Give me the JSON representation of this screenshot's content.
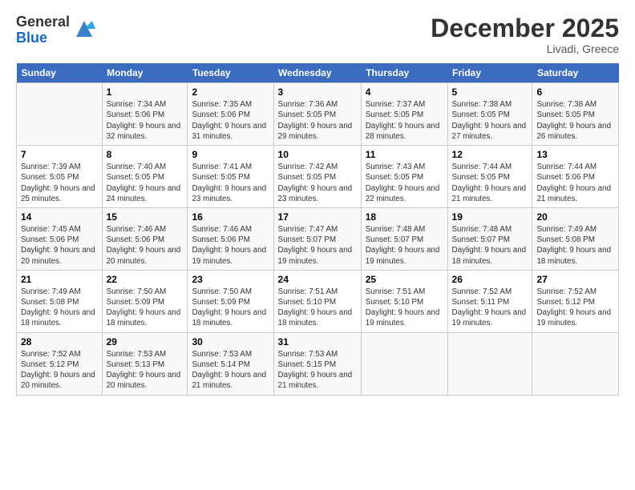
{
  "header": {
    "logo_general": "General",
    "logo_blue": "Blue",
    "month_title": "December 2025",
    "location": "Livadi, Greece"
  },
  "days_of_week": [
    "Sunday",
    "Monday",
    "Tuesday",
    "Wednesday",
    "Thursday",
    "Friday",
    "Saturday"
  ],
  "weeks": [
    [
      {
        "num": "",
        "sunrise": "",
        "sunset": "",
        "daylight": "",
        "empty": true
      },
      {
        "num": "1",
        "sunrise": "Sunrise: 7:34 AM",
        "sunset": "Sunset: 5:06 PM",
        "daylight": "Daylight: 9 hours and 32 minutes.",
        "empty": false
      },
      {
        "num": "2",
        "sunrise": "Sunrise: 7:35 AM",
        "sunset": "Sunset: 5:06 PM",
        "daylight": "Daylight: 9 hours and 31 minutes.",
        "empty": false
      },
      {
        "num": "3",
        "sunrise": "Sunrise: 7:36 AM",
        "sunset": "Sunset: 5:05 PM",
        "daylight": "Daylight: 9 hours and 29 minutes.",
        "empty": false
      },
      {
        "num": "4",
        "sunrise": "Sunrise: 7:37 AM",
        "sunset": "Sunset: 5:05 PM",
        "daylight": "Daylight: 9 hours and 28 minutes.",
        "empty": false
      },
      {
        "num": "5",
        "sunrise": "Sunrise: 7:38 AM",
        "sunset": "Sunset: 5:05 PM",
        "daylight": "Daylight: 9 hours and 27 minutes.",
        "empty": false
      },
      {
        "num": "6",
        "sunrise": "Sunrise: 7:38 AM",
        "sunset": "Sunset: 5:05 PM",
        "daylight": "Daylight: 9 hours and 26 minutes.",
        "empty": false
      }
    ],
    [
      {
        "num": "7",
        "sunrise": "Sunrise: 7:39 AM",
        "sunset": "Sunset: 5:05 PM",
        "daylight": "Daylight: 9 hours and 25 minutes.",
        "empty": false
      },
      {
        "num": "8",
        "sunrise": "Sunrise: 7:40 AM",
        "sunset": "Sunset: 5:05 PM",
        "daylight": "Daylight: 9 hours and 24 minutes.",
        "empty": false
      },
      {
        "num": "9",
        "sunrise": "Sunrise: 7:41 AM",
        "sunset": "Sunset: 5:05 PM",
        "daylight": "Daylight: 9 hours and 23 minutes.",
        "empty": false
      },
      {
        "num": "10",
        "sunrise": "Sunrise: 7:42 AM",
        "sunset": "Sunset: 5:05 PM",
        "daylight": "Daylight: 9 hours and 23 minutes.",
        "empty": false
      },
      {
        "num": "11",
        "sunrise": "Sunrise: 7:43 AM",
        "sunset": "Sunset: 5:05 PM",
        "daylight": "Daylight: 9 hours and 22 minutes.",
        "empty": false
      },
      {
        "num": "12",
        "sunrise": "Sunrise: 7:44 AM",
        "sunset": "Sunset: 5:05 PM",
        "daylight": "Daylight: 9 hours and 21 minutes.",
        "empty": false
      },
      {
        "num": "13",
        "sunrise": "Sunrise: 7:44 AM",
        "sunset": "Sunset: 5:06 PM",
        "daylight": "Daylight: 9 hours and 21 minutes.",
        "empty": false
      }
    ],
    [
      {
        "num": "14",
        "sunrise": "Sunrise: 7:45 AM",
        "sunset": "Sunset: 5:06 PM",
        "daylight": "Daylight: 9 hours and 20 minutes.",
        "empty": false
      },
      {
        "num": "15",
        "sunrise": "Sunrise: 7:46 AM",
        "sunset": "Sunset: 5:06 PM",
        "daylight": "Daylight: 9 hours and 20 minutes.",
        "empty": false
      },
      {
        "num": "16",
        "sunrise": "Sunrise: 7:46 AM",
        "sunset": "Sunset: 5:06 PM",
        "daylight": "Daylight: 9 hours and 19 minutes.",
        "empty": false
      },
      {
        "num": "17",
        "sunrise": "Sunrise: 7:47 AM",
        "sunset": "Sunset: 5:07 PM",
        "daylight": "Daylight: 9 hours and 19 minutes.",
        "empty": false
      },
      {
        "num": "18",
        "sunrise": "Sunrise: 7:48 AM",
        "sunset": "Sunset: 5:07 PM",
        "daylight": "Daylight: 9 hours and 19 minutes.",
        "empty": false
      },
      {
        "num": "19",
        "sunrise": "Sunrise: 7:48 AM",
        "sunset": "Sunset: 5:07 PM",
        "daylight": "Daylight: 9 hours and 18 minutes.",
        "empty": false
      },
      {
        "num": "20",
        "sunrise": "Sunrise: 7:49 AM",
        "sunset": "Sunset: 5:08 PM",
        "daylight": "Daylight: 9 hours and 18 minutes.",
        "empty": false
      }
    ],
    [
      {
        "num": "21",
        "sunrise": "Sunrise: 7:49 AM",
        "sunset": "Sunset: 5:08 PM",
        "daylight": "Daylight: 9 hours and 18 minutes.",
        "empty": false
      },
      {
        "num": "22",
        "sunrise": "Sunrise: 7:50 AM",
        "sunset": "Sunset: 5:09 PM",
        "daylight": "Daylight: 9 hours and 18 minutes.",
        "empty": false
      },
      {
        "num": "23",
        "sunrise": "Sunrise: 7:50 AM",
        "sunset": "Sunset: 5:09 PM",
        "daylight": "Daylight: 9 hours and 18 minutes.",
        "empty": false
      },
      {
        "num": "24",
        "sunrise": "Sunrise: 7:51 AM",
        "sunset": "Sunset: 5:10 PM",
        "daylight": "Daylight: 9 hours and 18 minutes.",
        "empty": false
      },
      {
        "num": "25",
        "sunrise": "Sunrise: 7:51 AM",
        "sunset": "Sunset: 5:10 PM",
        "daylight": "Daylight: 9 hours and 19 minutes.",
        "empty": false
      },
      {
        "num": "26",
        "sunrise": "Sunrise: 7:52 AM",
        "sunset": "Sunset: 5:11 PM",
        "daylight": "Daylight: 9 hours and 19 minutes.",
        "empty": false
      },
      {
        "num": "27",
        "sunrise": "Sunrise: 7:52 AM",
        "sunset": "Sunset: 5:12 PM",
        "daylight": "Daylight: 9 hours and 19 minutes.",
        "empty": false
      }
    ],
    [
      {
        "num": "28",
        "sunrise": "Sunrise: 7:52 AM",
        "sunset": "Sunset: 5:12 PM",
        "daylight": "Daylight: 9 hours and 20 minutes.",
        "empty": false
      },
      {
        "num": "29",
        "sunrise": "Sunrise: 7:53 AM",
        "sunset": "Sunset: 5:13 PM",
        "daylight": "Daylight: 9 hours and 20 minutes.",
        "empty": false
      },
      {
        "num": "30",
        "sunrise": "Sunrise: 7:53 AM",
        "sunset": "Sunset: 5:14 PM",
        "daylight": "Daylight: 9 hours and 21 minutes.",
        "empty": false
      },
      {
        "num": "31",
        "sunrise": "Sunrise: 7:53 AM",
        "sunset": "Sunset: 5:15 PM",
        "daylight": "Daylight: 9 hours and 21 minutes.",
        "empty": false
      },
      {
        "num": "",
        "sunrise": "",
        "sunset": "",
        "daylight": "",
        "empty": true
      },
      {
        "num": "",
        "sunrise": "",
        "sunset": "",
        "daylight": "",
        "empty": true
      },
      {
        "num": "",
        "sunrise": "",
        "sunset": "",
        "daylight": "",
        "empty": true
      }
    ]
  ]
}
